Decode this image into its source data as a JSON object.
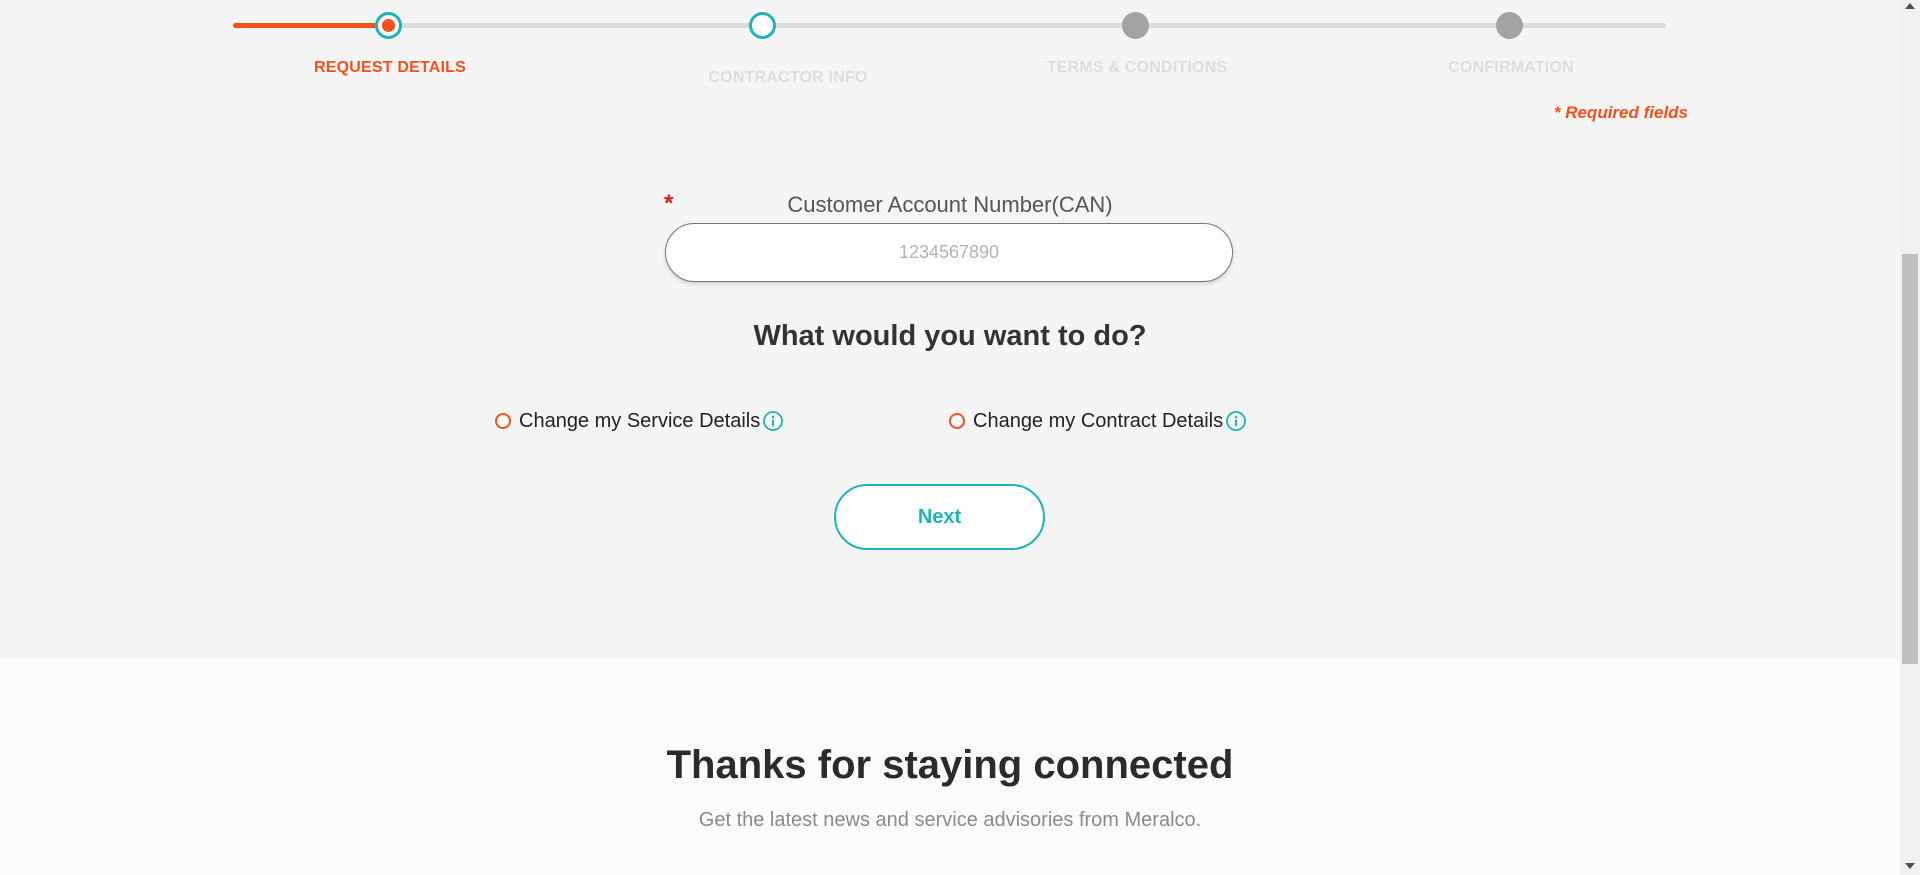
{
  "stepper": {
    "steps": [
      {
        "label": "REQUEST DETAILS",
        "state": "active"
      },
      {
        "label": "CONTRACTOR INFO",
        "state": "next"
      },
      {
        "label": "TERMS & CONDITIONS",
        "state": "pending"
      },
      {
        "label": "CONFIRMATION",
        "state": "pending"
      }
    ],
    "progress_percent": 11
  },
  "form": {
    "required_note": "* Required fields",
    "asterisk": "*",
    "can_label": "Customer Account Number(CAN)",
    "can_placeholder": "1234567890",
    "can_value": "",
    "question": "What would you want to do?",
    "options": [
      {
        "label": "Change my Service Details",
        "selected": false,
        "info_icon": "info-icon"
      },
      {
        "label": "Change my Contract Details",
        "selected": false,
        "info_icon": "info-icon"
      }
    ],
    "next_label": "Next"
  },
  "footer": {
    "title": "Thanks for staying connected",
    "subtitle": "Get the latest news and service advisories from Meralco."
  },
  "colors": {
    "accent_orange": "#f4511e",
    "accent_teal": "#1eb3b9",
    "inactive_gray": "#a3a3a3",
    "required_red": "#e0191f"
  }
}
